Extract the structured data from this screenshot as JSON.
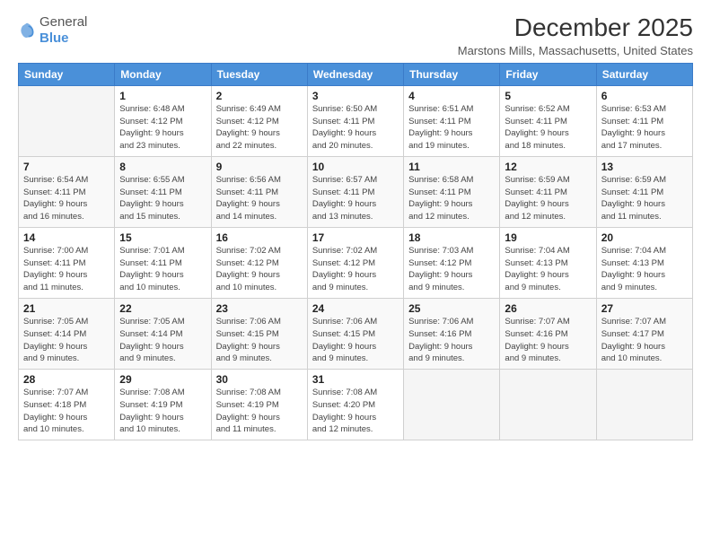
{
  "logo": {
    "general": "General",
    "blue": "Blue"
  },
  "header": {
    "title": "December 2025",
    "subtitle": "Marstons Mills, Massachusetts, United States"
  },
  "calendar": {
    "days_of_week": [
      "Sunday",
      "Monday",
      "Tuesday",
      "Wednesday",
      "Thursday",
      "Friday",
      "Saturday"
    ],
    "weeks": [
      [
        {
          "day": "",
          "info": ""
        },
        {
          "day": "1",
          "info": "Sunrise: 6:48 AM\nSunset: 4:12 PM\nDaylight: 9 hours\nand 23 minutes."
        },
        {
          "day": "2",
          "info": "Sunrise: 6:49 AM\nSunset: 4:12 PM\nDaylight: 9 hours\nand 22 minutes."
        },
        {
          "day": "3",
          "info": "Sunrise: 6:50 AM\nSunset: 4:11 PM\nDaylight: 9 hours\nand 20 minutes."
        },
        {
          "day": "4",
          "info": "Sunrise: 6:51 AM\nSunset: 4:11 PM\nDaylight: 9 hours\nand 19 minutes."
        },
        {
          "day": "5",
          "info": "Sunrise: 6:52 AM\nSunset: 4:11 PM\nDaylight: 9 hours\nand 18 minutes."
        },
        {
          "day": "6",
          "info": "Sunrise: 6:53 AM\nSunset: 4:11 PM\nDaylight: 9 hours\nand 17 minutes."
        }
      ],
      [
        {
          "day": "7",
          "info": "Sunrise: 6:54 AM\nSunset: 4:11 PM\nDaylight: 9 hours\nand 16 minutes."
        },
        {
          "day": "8",
          "info": "Sunrise: 6:55 AM\nSunset: 4:11 PM\nDaylight: 9 hours\nand 15 minutes."
        },
        {
          "day": "9",
          "info": "Sunrise: 6:56 AM\nSunset: 4:11 PM\nDaylight: 9 hours\nand 14 minutes."
        },
        {
          "day": "10",
          "info": "Sunrise: 6:57 AM\nSunset: 4:11 PM\nDaylight: 9 hours\nand 13 minutes."
        },
        {
          "day": "11",
          "info": "Sunrise: 6:58 AM\nSunset: 4:11 PM\nDaylight: 9 hours\nand 12 minutes."
        },
        {
          "day": "12",
          "info": "Sunrise: 6:59 AM\nSunset: 4:11 PM\nDaylight: 9 hours\nand 12 minutes."
        },
        {
          "day": "13",
          "info": "Sunrise: 6:59 AM\nSunset: 4:11 PM\nDaylight: 9 hours\nand 11 minutes."
        }
      ],
      [
        {
          "day": "14",
          "info": "Sunrise: 7:00 AM\nSunset: 4:11 PM\nDaylight: 9 hours\nand 11 minutes."
        },
        {
          "day": "15",
          "info": "Sunrise: 7:01 AM\nSunset: 4:11 PM\nDaylight: 9 hours\nand 10 minutes."
        },
        {
          "day": "16",
          "info": "Sunrise: 7:02 AM\nSunset: 4:12 PM\nDaylight: 9 hours\nand 10 minutes."
        },
        {
          "day": "17",
          "info": "Sunrise: 7:02 AM\nSunset: 4:12 PM\nDaylight: 9 hours\nand 9 minutes."
        },
        {
          "day": "18",
          "info": "Sunrise: 7:03 AM\nSunset: 4:12 PM\nDaylight: 9 hours\nand 9 minutes."
        },
        {
          "day": "19",
          "info": "Sunrise: 7:04 AM\nSunset: 4:13 PM\nDaylight: 9 hours\nand 9 minutes."
        },
        {
          "day": "20",
          "info": "Sunrise: 7:04 AM\nSunset: 4:13 PM\nDaylight: 9 hours\nand 9 minutes."
        }
      ],
      [
        {
          "day": "21",
          "info": "Sunrise: 7:05 AM\nSunset: 4:14 PM\nDaylight: 9 hours\nand 9 minutes."
        },
        {
          "day": "22",
          "info": "Sunrise: 7:05 AM\nSunset: 4:14 PM\nDaylight: 9 hours\nand 9 minutes."
        },
        {
          "day": "23",
          "info": "Sunrise: 7:06 AM\nSunset: 4:15 PM\nDaylight: 9 hours\nand 9 minutes."
        },
        {
          "day": "24",
          "info": "Sunrise: 7:06 AM\nSunset: 4:15 PM\nDaylight: 9 hours\nand 9 minutes."
        },
        {
          "day": "25",
          "info": "Sunrise: 7:06 AM\nSunset: 4:16 PM\nDaylight: 9 hours\nand 9 minutes."
        },
        {
          "day": "26",
          "info": "Sunrise: 7:07 AM\nSunset: 4:16 PM\nDaylight: 9 hours\nand 9 minutes."
        },
        {
          "day": "27",
          "info": "Sunrise: 7:07 AM\nSunset: 4:17 PM\nDaylight: 9 hours\nand 10 minutes."
        }
      ],
      [
        {
          "day": "28",
          "info": "Sunrise: 7:07 AM\nSunset: 4:18 PM\nDaylight: 9 hours\nand 10 minutes."
        },
        {
          "day": "29",
          "info": "Sunrise: 7:08 AM\nSunset: 4:19 PM\nDaylight: 9 hours\nand 10 minutes."
        },
        {
          "day": "30",
          "info": "Sunrise: 7:08 AM\nSunset: 4:19 PM\nDaylight: 9 hours\nand 11 minutes."
        },
        {
          "day": "31",
          "info": "Sunrise: 7:08 AM\nSunset: 4:20 PM\nDaylight: 9 hours\nand 12 minutes."
        },
        {
          "day": "",
          "info": ""
        },
        {
          "day": "",
          "info": ""
        },
        {
          "day": "",
          "info": ""
        }
      ]
    ]
  }
}
